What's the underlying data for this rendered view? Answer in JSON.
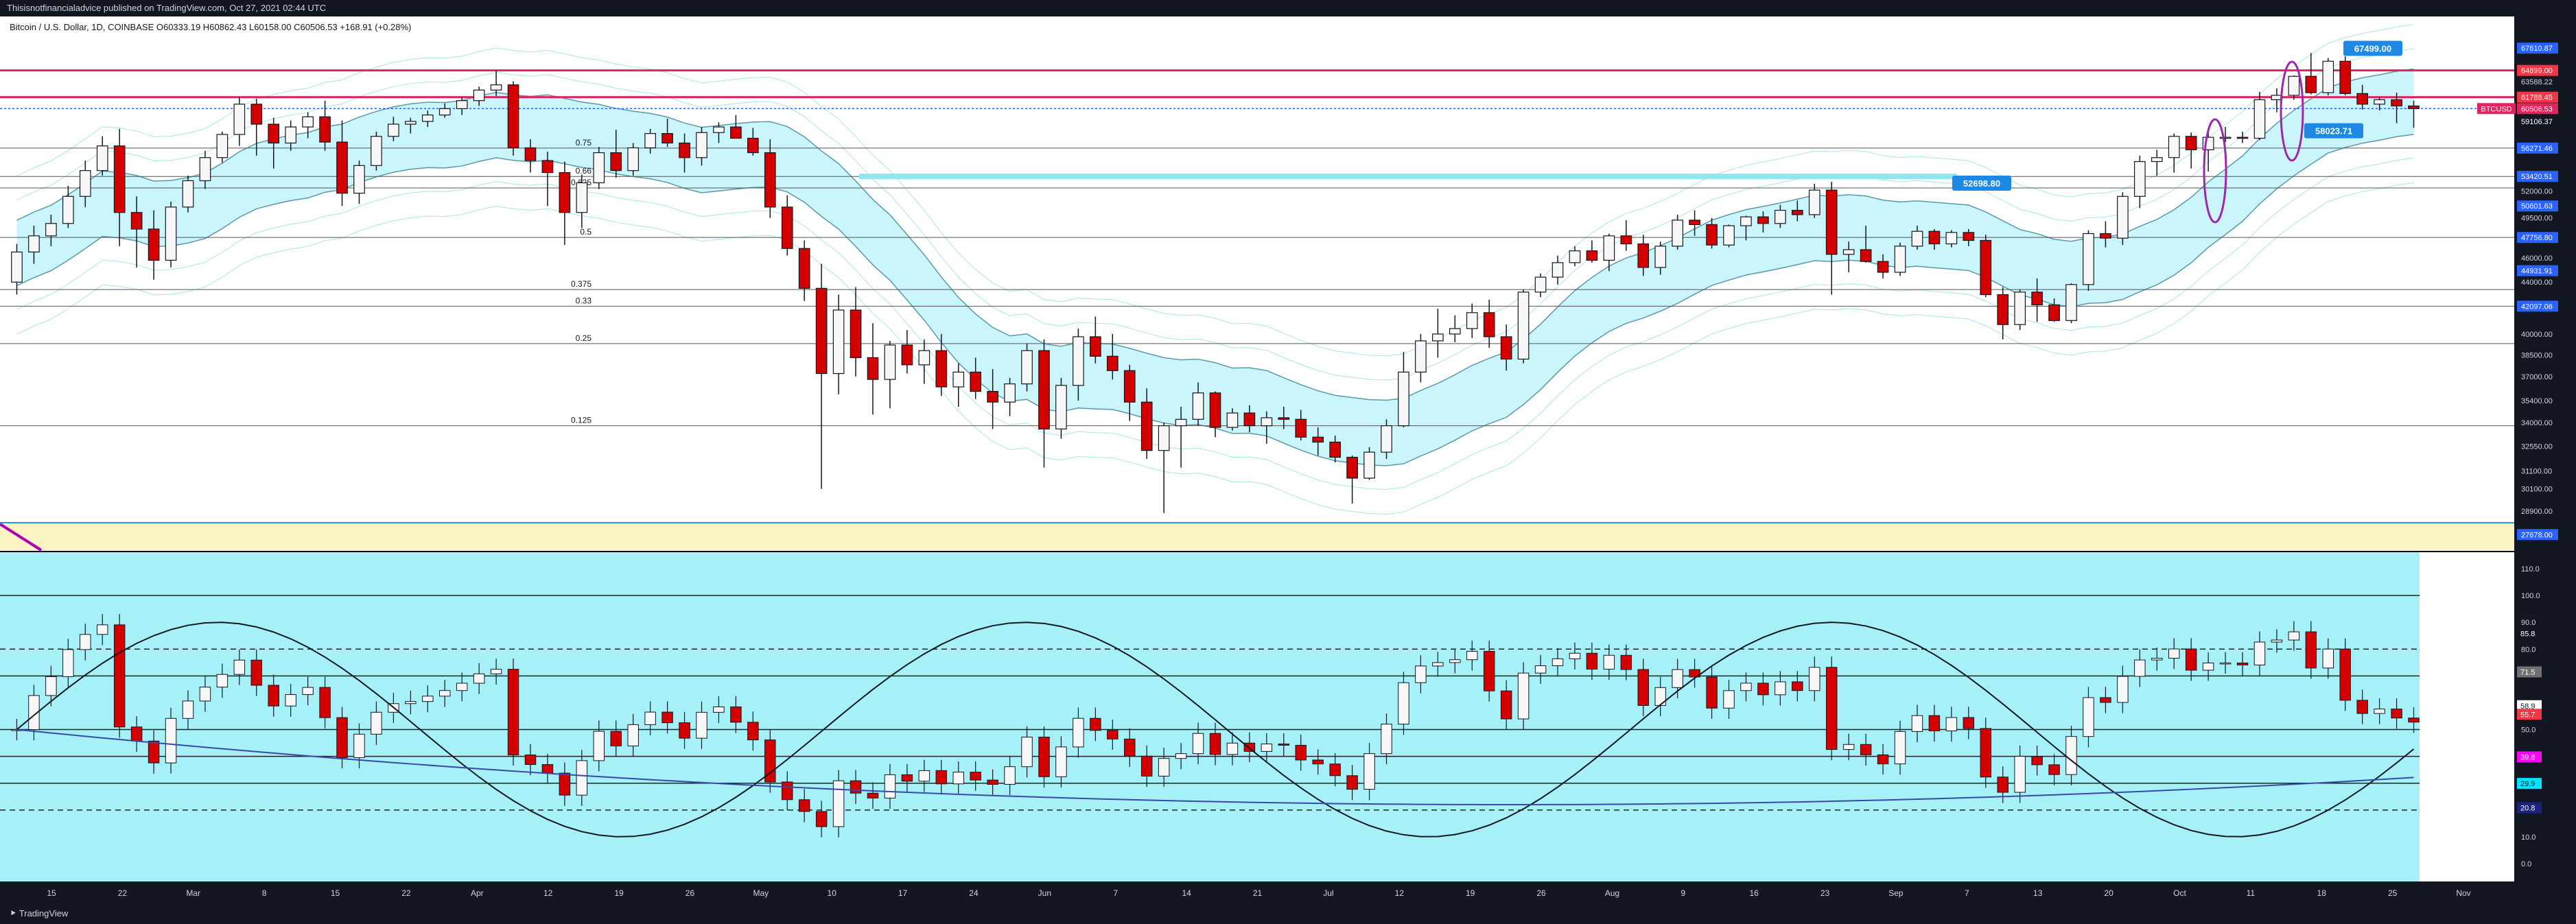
{
  "publisher_line": "Thisisnotfinancialadvice published on TradingView.com, Oct 27, 2021 02:44 UTC",
  "footer_brand": "TradingView",
  "chart_data": {
    "type": "candlestick",
    "symbol_line": "Bitcoin / U.S. Dollar, 1D, COINBASE  O60333.19  H60862.43  L60158.00  C60506.53  +168.91 (+0.28%)",
    "ticker_label": "BTCUSD",
    "last_price": 60506.53,
    "price_axis": {
      "scale": "log",
      "range": [
        27000,
        69000
      ],
      "ticks": [
        "63588.22",
        "52000.00",
        "49500.00",
        "46000.00",
        "44000.00",
        "42000.00",
        "40000.00",
        "38500.00",
        "37000.00",
        "35400.00",
        "34000.00",
        "32550.00",
        "31100.00",
        "30100.00",
        "28900.00"
      ]
    },
    "price_levels": [
      {
        "label": "67610.87",
        "value": 67610.87,
        "color": "#2962ff"
      },
      {
        "label": "64899.00",
        "value": 64899,
        "color": "#f23645"
      },
      {
        "label": "61788.45",
        "value": 61788.45,
        "color": "#f23645"
      },
      {
        "label": "59106.37",
        "value": 59106.37,
        "color": "#131722"
      },
      {
        "label": "56271.46",
        "value": 56271.46,
        "color": "#2962ff"
      },
      {
        "label": "53420.51",
        "value": 53420.51,
        "color": "#2962ff"
      },
      {
        "label": "50601.63",
        "value": 50601.63,
        "color": "#2962ff"
      },
      {
        "label": "47756.80",
        "value": 47756.8,
        "color": "#2962ff"
      },
      {
        "label": "44931.91",
        "value": 44931.91,
        "color": "#2962ff"
      },
      {
        "label": "42097.06",
        "value": 42097.06,
        "color": "#2962ff"
      },
      {
        "label": "27678.00",
        "value": 27678,
        "color": "#2962ff"
      }
    ],
    "fib_levels": [
      {
        "label": "0.75",
        "value": 56271.46
      },
      {
        "label": "0.66",
        "value": 53420.51
      },
      {
        "label": "0.625",
        "value": 52300
      },
      {
        "label": "0.5",
        "value": 47756.8
      },
      {
        "label": "0.375",
        "value": 43400
      },
      {
        "label": "0.33",
        "value": 42097.06
      },
      {
        "label": "0.25",
        "value": 39300
      },
      {
        "label": "0.125",
        "value": 33800
      }
    ],
    "callouts": [
      {
        "label": "52698.80",
        "value": 52698.8
      },
      {
        "label": "67499.00",
        "value": 67499
      },
      {
        "label": "58023.71",
        "value": 58023.71
      }
    ],
    "x_labels": [
      "15",
      "22",
      "Mar",
      "8",
      "15",
      "22",
      "Apr",
      "12",
      "19",
      "26",
      "May",
      "10",
      "17",
      "24",
      "Jun",
      "7",
      "14",
      "21",
      "Jul",
      "12",
      "19",
      "26",
      "Aug",
      "9",
      "16",
      "23",
      "Sep",
      "7",
      "13",
      "20",
      "Oct",
      "11",
      "18",
      "25",
      "Nov"
    ],
    "candles": [
      [
        44000,
        47200,
        43000,
        46500
      ],
      [
        46500,
        48800,
        45500,
        47900
      ],
      [
        47900,
        49800,
        47000,
        49000
      ],
      [
        49000,
        52500,
        48600,
        51500
      ],
      [
        51500,
        55000,
        50500,
        54000
      ],
      [
        54000,
        57500,
        53500,
        56500
      ],
      [
        56500,
        58300,
        47000,
        50000
      ],
      [
        50000,
        51500,
        45200,
        48500
      ],
      [
        48500,
        50200,
        44200,
        45800
      ],
      [
        45800,
        51000,
        45200,
        50500
      ],
      [
        50500,
        53500,
        50000,
        53000
      ],
      [
        53000,
        56000,
        52200,
        55300
      ],
      [
        55300,
        58000,
        54800,
        57700
      ],
      [
        57700,
        61800,
        56500,
        61000
      ],
      [
        61000,
        61600,
        55500,
        58800
      ],
      [
        58800,
        59500,
        54200,
        56800
      ],
      [
        56800,
        59200,
        56000,
        58500
      ],
      [
        58500,
        60100,
        57300,
        59600
      ],
      [
        59600,
        61400,
        56000,
        56900
      ],
      [
        56900,
        59200,
        50600,
        51800
      ],
      [
        51800,
        55000,
        50800,
        54500
      ],
      [
        54500,
        58000,
        54000,
        57500
      ],
      [
        57500,
        59600,
        57000,
        58800
      ],
      [
        58800,
        59500,
        57800,
        59100
      ],
      [
        59100,
        60300,
        58500,
        59800
      ],
      [
        59800,
        61100,
        59500,
        60500
      ],
      [
        60500,
        61800,
        59800,
        61400
      ],
      [
        61400,
        63000,
        60800,
        62600
      ],
      [
        62600,
        64899,
        61900,
        63200
      ],
      [
        63200,
        63600,
        55500,
        56300
      ],
      [
        56300,
        57200,
        53800,
        55000
      ],
      [
        55000,
        55900,
        50600,
        53800
      ],
      [
        53800,
        54900,
        47100,
        50000
      ],
      [
        50000,
        53600,
        48600,
        52800
      ],
      [
        52800,
        56400,
        52200,
        55800
      ],
      [
        55800,
        58200,
        53300,
        54000
      ],
      [
        54000,
        56800,
        53500,
        56300
      ],
      [
        56300,
        58300,
        55700,
        57800
      ],
      [
        57800,
        59400,
        56400,
        56800
      ],
      [
        56800,
        57800,
        53800,
        55300
      ],
      [
        55300,
        58500,
        54500,
        57900
      ],
      [
        57900,
        59000,
        56800,
        58500
      ],
      [
        58500,
        59800,
        57600,
        57300
      ],
      [
        57300,
        58400,
        55500,
        55800
      ],
      [
        55800,
        57200,
        49500,
        50500
      ],
      [
        50500,
        51600,
        46200,
        46800
      ],
      [
        46800,
        47500,
        42500,
        43500
      ],
      [
        43500,
        45500,
        30100,
        37200
      ],
      [
        37200,
        43000,
        35800,
        41800
      ],
      [
        41800,
        43600,
        37000,
        38300
      ],
      [
        38300,
        40800,
        34500,
        36800
      ],
      [
        36800,
        39500,
        34900,
        39200
      ],
      [
        39200,
        40300,
        37200,
        37800
      ],
      [
        37800,
        39600,
        36500,
        38800
      ],
      [
        38800,
        40000,
        35700,
        36300
      ],
      [
        36300,
        37900,
        35000,
        37300
      ],
      [
        37300,
        38300,
        35500,
        36000
      ],
      [
        36000,
        37500,
        33600,
        35300
      ],
      [
        35300,
        36900,
        34400,
        36500
      ],
      [
        36500,
        39300,
        36000,
        38800
      ],
      [
        38800,
        39600,
        31300,
        33600
      ],
      [
        33600,
        36900,
        33000,
        36400
      ],
      [
        36400,
        40400,
        35400,
        39800
      ],
      [
        39800,
        41300,
        37900,
        38400
      ],
      [
        38400,
        40000,
        36800,
        37400
      ],
      [
        37400,
        37800,
        34100,
        35300
      ],
      [
        35300,
        36200,
        31800,
        32300
      ],
      [
        32300,
        34000,
        28800,
        33800
      ],
      [
        33800,
        35000,
        31300,
        34200
      ],
      [
        34200,
        36600,
        33800,
        35900
      ],
      [
        35900,
        36000,
        33100,
        33700
      ],
      [
        33700,
        34900,
        33500,
        34600
      ],
      [
        34600,
        35100,
        33400,
        33800
      ],
      [
        33800,
        34700,
        32700,
        34300
      ],
      [
        34300,
        35000,
        33600,
        34200
      ],
      [
        34200,
        34800,
        32900,
        33100
      ],
      [
        33100,
        33700,
        32000,
        32800
      ],
      [
        32800,
        33200,
        31600,
        31900
      ],
      [
        31900,
        32000,
        29300,
        30700
      ],
      [
        30700,
        32500,
        30600,
        32200
      ],
      [
        32200,
        34200,
        31800,
        33800
      ],
      [
        33800,
        38700,
        33700,
        37300
      ],
      [
        37300,
        40000,
        36600,
        39500
      ],
      [
        39500,
        41900,
        38300,
        40000
      ],
      [
        40000,
        41400,
        39400,
        40400
      ],
      [
        40400,
        42300,
        39700,
        41600
      ],
      [
        41600,
        42600,
        39000,
        39800
      ],
      [
        39800,
        40700,
        37400,
        38200
      ],
      [
        38200,
        43400,
        37900,
        43200
      ],
      [
        43200,
        44700,
        42800,
        44400
      ],
      [
        44400,
        46200,
        43800,
        45600
      ],
      [
        45600,
        47000,
        45300,
        46600
      ],
      [
        46600,
        47500,
        45600,
        45800
      ],
      [
        45800,
        48100,
        44900,
        47900
      ],
      [
        47900,
        49300,
        46600,
        47200
      ],
      [
        47200,
        48000,
        44500,
        45200
      ],
      [
        45200,
        47400,
        44600,
        47000
      ],
      [
        47000,
        49800,
        46700,
        49300
      ],
      [
        49300,
        50200,
        47900,
        48900
      ],
      [
        48900,
        49500,
        46800,
        47100
      ],
      [
        47100,
        48900,
        46900,
        48800
      ],
      [
        48800,
        49700,
        47500,
        49600
      ],
      [
        49600,
        50100,
        48200,
        49000
      ],
      [
        49000,
        50700,
        48600,
        50200
      ],
      [
        50200,
        51100,
        49200,
        49800
      ],
      [
        49800,
        52700,
        49500,
        52100
      ],
      [
        52100,
        52900,
        43000,
        46300
      ],
      [
        46300,
        47400,
        44800,
        46700
      ],
      [
        46700,
        48800,
        45600,
        45700
      ],
      [
        45700,
        46300,
        44300,
        44800
      ],
      [
        44800,
        47300,
        44500,
        47000
      ],
      [
        47000,
        48800,
        46700,
        48300
      ],
      [
        48300,
        48500,
        46700,
        47200
      ],
      [
        47200,
        48400,
        46900,
        48200
      ],
      [
        48200,
        48500,
        47000,
        47500
      ],
      [
        47500,
        48000,
        42800,
        43000
      ],
      [
        43000,
        43600,
        39600,
        40700
      ],
      [
        40700,
        43400,
        40300,
        43200
      ],
      [
        43200,
        44300,
        40900,
        42200
      ],
      [
        42200,
        42700,
        40900,
        41000
      ],
      [
        41000,
        43900,
        40800,
        43800
      ],
      [
        43800,
        48400,
        43300,
        48100
      ],
      [
        48100,
        49200,
        46900,
        47700
      ],
      [
        47700,
        51900,
        47100,
        51500
      ],
      [
        51500,
        55500,
        50400,
        54900
      ],
      [
        54900,
        56100,
        53500,
        55300
      ],
      [
        55300,
        57800,
        53800,
        57500
      ],
      [
        57500,
        57900,
        54200,
        56100
      ],
      [
        56100,
        57900,
        53900,
        57400
      ],
      [
        57400,
        58500,
        56900,
        57400
      ],
      [
        57400,
        58000,
        56800,
        57300
      ],
      [
        57300,
        62400,
        57100,
        61500
      ],
      [
        61500,
        62800,
        60100,
        62000
      ],
      [
        62000,
        64300,
        61500,
        64200
      ],
      [
        64200,
        67000,
        62100,
        62300
      ],
      [
        62300,
        66400,
        62000,
        66000
      ],
      [
        66000,
        66600,
        62000,
        62200
      ],
      [
        62200,
        63200,
        60400,
        61000
      ],
      [
        61000,
        61800,
        60300,
        61500
      ],
      [
        61500,
        62300,
        58900,
        60800
      ],
      [
        60800,
        61400,
        58400,
        60500
      ]
    ],
    "oscillator": {
      "range": [
        0,
        110
      ],
      "ticks": [
        "110.0",
        "100.0",
        "90.0",
        "80.0",
        "71.5",
        "50.0",
        "40.0",
        "10.0",
        "0.0"
      ],
      "level_labels": [
        {
          "label": "85.8",
          "value": 85.8,
          "color": "#131722"
        },
        {
          "label": "71.5",
          "value": 71.5,
          "color": "#707070"
        },
        {
          "label": "58.9",
          "value": 58.9,
          "color": "#ffffff"
        },
        {
          "label": "55.7",
          "value": 55.7,
          "color": "#f23645"
        },
        {
          "label": "39.8",
          "value": 39.8,
          "color": "#ff00ff"
        },
        {
          "label": "29.9",
          "value": 29.9,
          "color": "#00e5ff"
        },
        {
          "label": "20.8",
          "value": 20.8,
          "color": "#1a237e"
        }
      ],
      "dashed_levels": [
        80,
        20
      ],
      "solid_levels": [
        100,
        70,
        50,
        40,
        30
      ]
    }
  }
}
